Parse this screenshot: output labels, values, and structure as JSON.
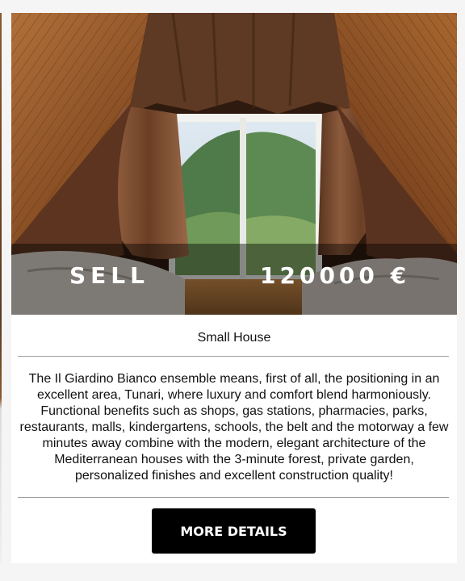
{
  "listing": {
    "image_alt": "attic bedroom with window overlooking mountains",
    "deal_type": "SELL",
    "price": "120000 €",
    "title": "Small House",
    "description": "The Il Giardino Bianco ensemble means, first of all, the positioning in an excellent area, Tunari, where luxury and comfort blend harmoniously. Functional benefits such as shops, gas stations, pharmacies, parks, restaurants, malls, kindergartens, schools, the belt and the motorway a few minutes away combine with the modern, elegant architecture of the Mediterranean houses with the 3-minute forest, private garden, personalized finishes and excellent construction quality!",
    "button_label": "MORE DETAILS"
  },
  "colors": {
    "page_bg": "#f5f5f5",
    "card_bg": "#ffffff",
    "button_bg": "#000000",
    "button_text": "#ffffff",
    "divider": "#9e9e9e"
  }
}
